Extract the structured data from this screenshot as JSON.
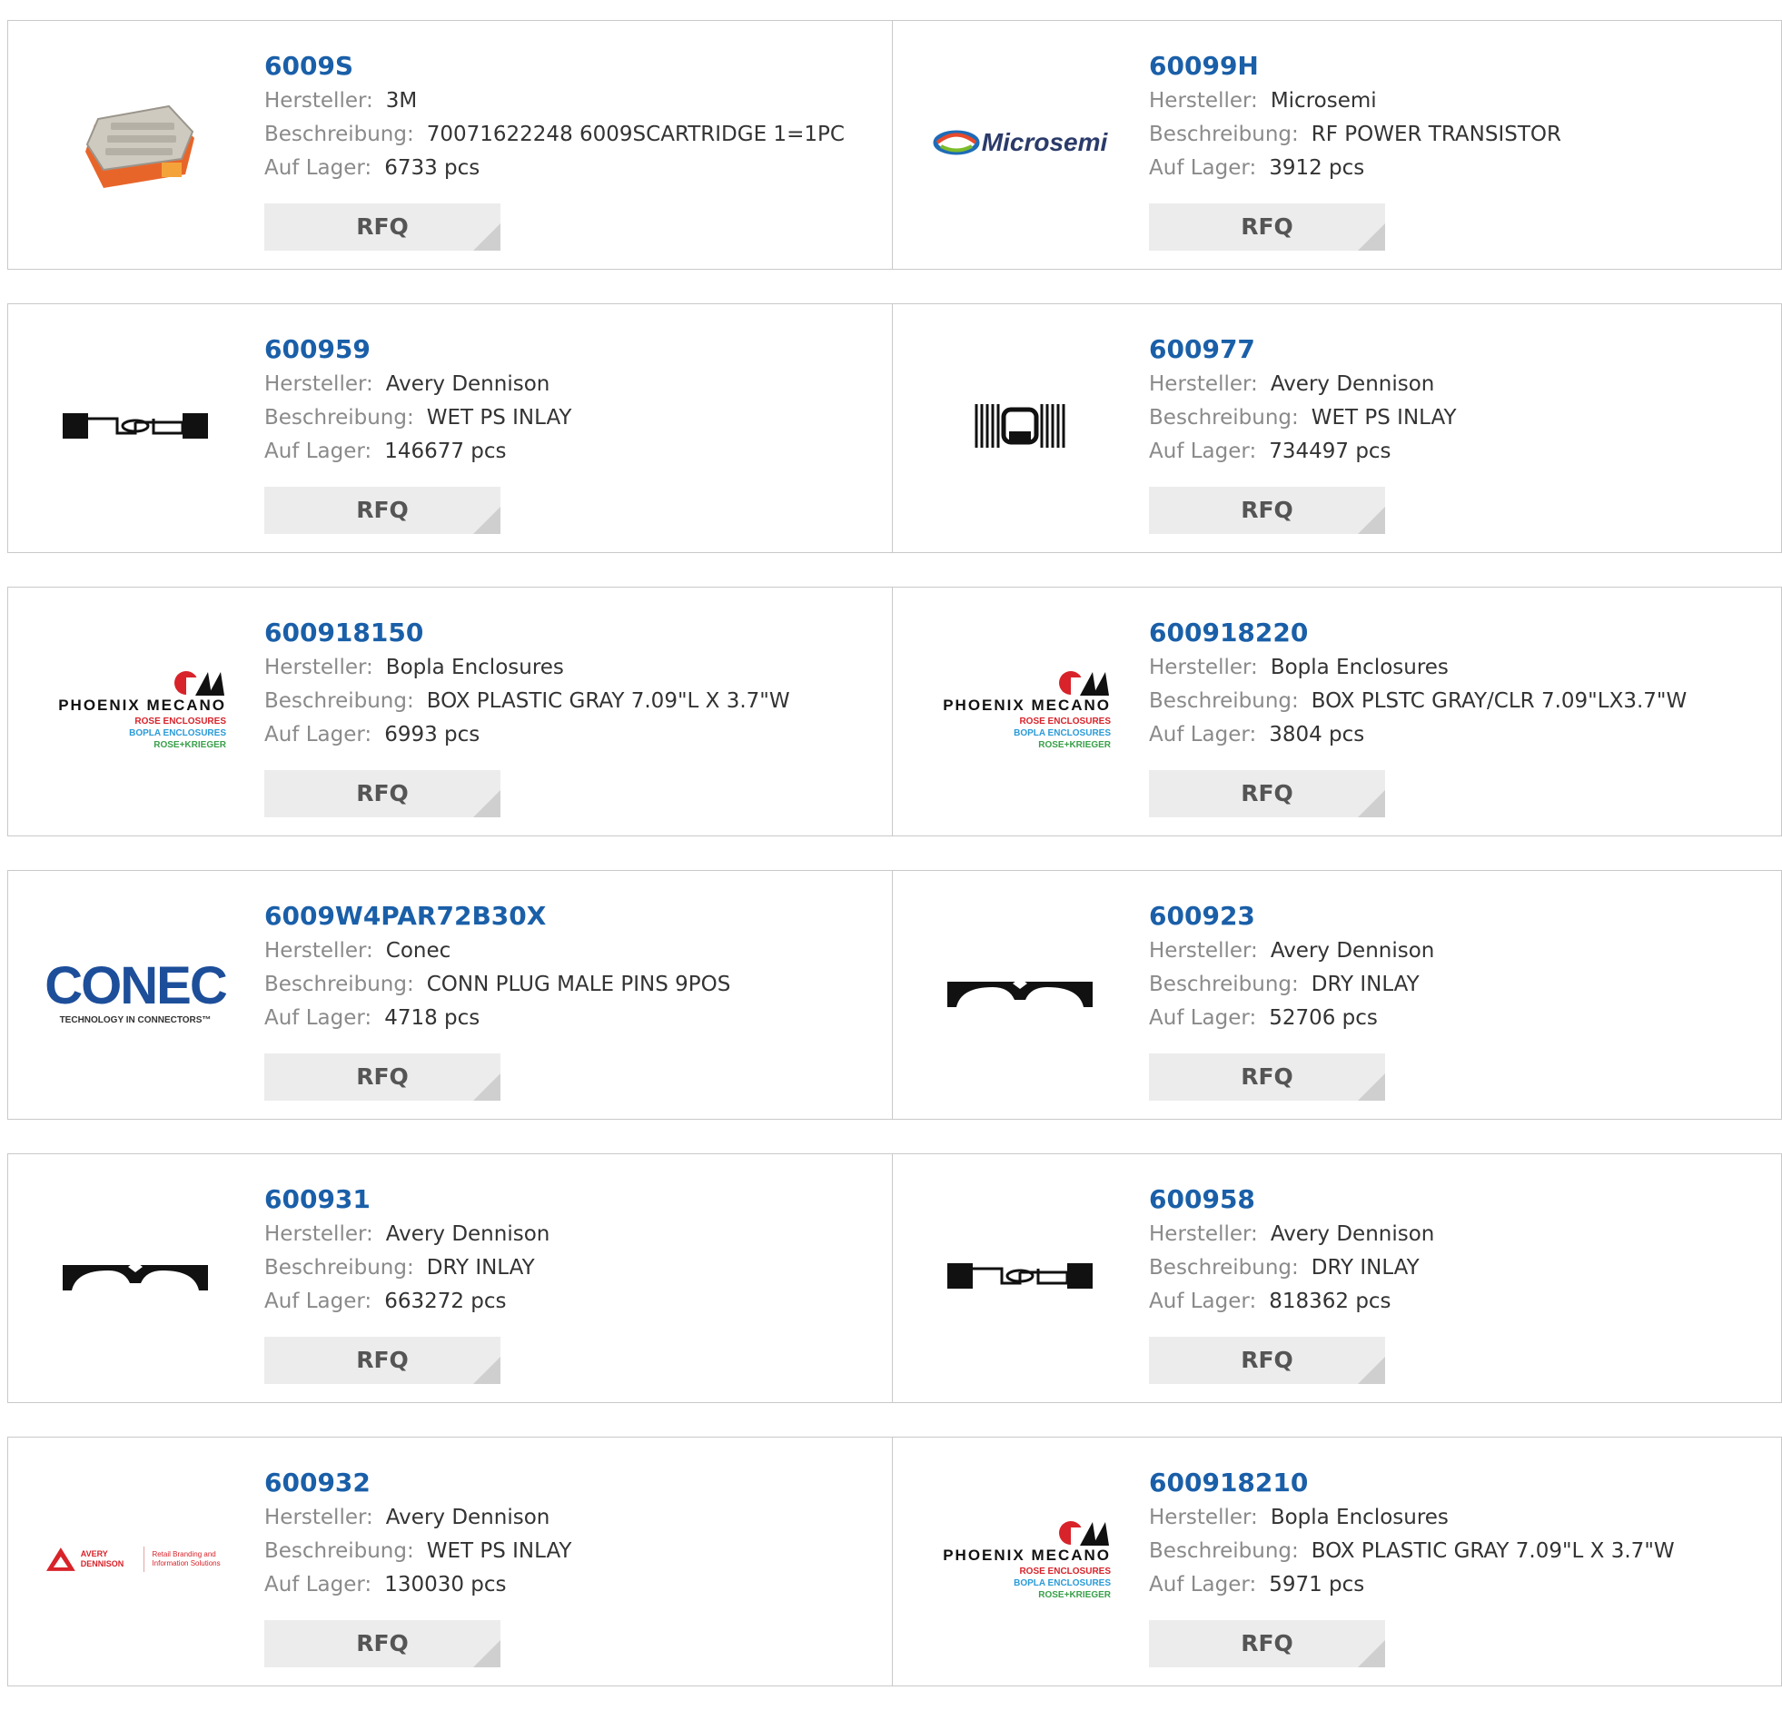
{
  "labels": {
    "manufacturer": "Hersteller:",
    "description": "Beschreibung:",
    "stock": "Auf Lager:",
    "rfq": "RFQ"
  },
  "logo_text": {
    "microsemi": "Microsemi",
    "phoenix": "PHOENIX MECANO",
    "rose": "ROSE ENCLOSURES",
    "bopla": "BOPLA ENCLOSURES",
    "krieger": "ROSE+KRIEGER",
    "conec": "CONEC",
    "conec_tag": "TECHNOLOGY IN CONNECTORS™",
    "avery": "AVERY DENNISON",
    "avery_tag": "Retail Branding and Information Solutions"
  },
  "products": [
    {
      "part": "6009S",
      "manufacturer": "3M",
      "description": "70071622248 6009SCARTRIDGE 1=1PC",
      "stock": "6733 pcs",
      "image": "cartridge-image"
    },
    {
      "part": "60099H",
      "manufacturer": "Microsemi",
      "description": "RF POWER TRANSISTOR",
      "stock": "3912 pcs",
      "image": "microsemi-logo"
    },
    {
      "part": "600959",
      "manufacturer": "Avery Dennison",
      "description": "WET PS INLAY",
      "stock": "146677 pcs",
      "image": "rfid-inlay-image"
    },
    {
      "part": "600977",
      "manufacturer": "Avery Dennison",
      "description": "WET PS INLAY",
      "stock": "734497 pcs",
      "image": "rfid-square-inlay-image"
    },
    {
      "part": "600918150",
      "manufacturer": "Bopla Enclosures",
      "description": "BOX PLASTIC GRAY 7.09\"L X 3.7\"W",
      "stock": "6993 pcs",
      "image": "phoenix-mecano-logo"
    },
    {
      "part": "600918220",
      "manufacturer": "Bopla Enclosures",
      "description": "BOX PLSTC GRAY/CLR 7.09\"LX3.7\"W",
      "stock": "3804 pcs",
      "image": "phoenix-mecano-logo"
    },
    {
      "part": "6009W4PAR72B30X",
      "manufacturer": "Conec",
      "description": "CONN PLUG MALE PINS 9POS",
      "stock": "4718 pcs",
      "image": "conec-logo"
    },
    {
      "part": "600923",
      "manufacturer": "Avery Dennison",
      "description": "DRY INLAY",
      "stock": "52706 pcs",
      "image": "arch-inlay-image"
    },
    {
      "part": "600931",
      "manufacturer": "Avery Dennison",
      "description": "DRY INLAY",
      "stock": "663272 pcs",
      "image": "arch-inlay-image"
    },
    {
      "part": "600958",
      "manufacturer": "Avery Dennison",
      "description": "DRY INLAY",
      "stock": "818362 pcs",
      "image": "rfid-inlay-image"
    },
    {
      "part": "600932",
      "manufacturer": "Avery Dennison",
      "description": "WET PS INLAY",
      "stock": "130030 pcs",
      "image": "avery-dennison-logo"
    },
    {
      "part": "600918210",
      "manufacturer": "Bopla Enclosures",
      "description": "BOX PLASTIC GRAY 7.09\"L X 3.7\"W",
      "stock": "5971 pcs",
      "image": "phoenix-mecano-logo"
    }
  ],
  "colors": {
    "part_link": "#1a5fa8",
    "label": "#8a8a8a",
    "rfq_bg": "#ececec",
    "border": "#c9c9c9"
  }
}
